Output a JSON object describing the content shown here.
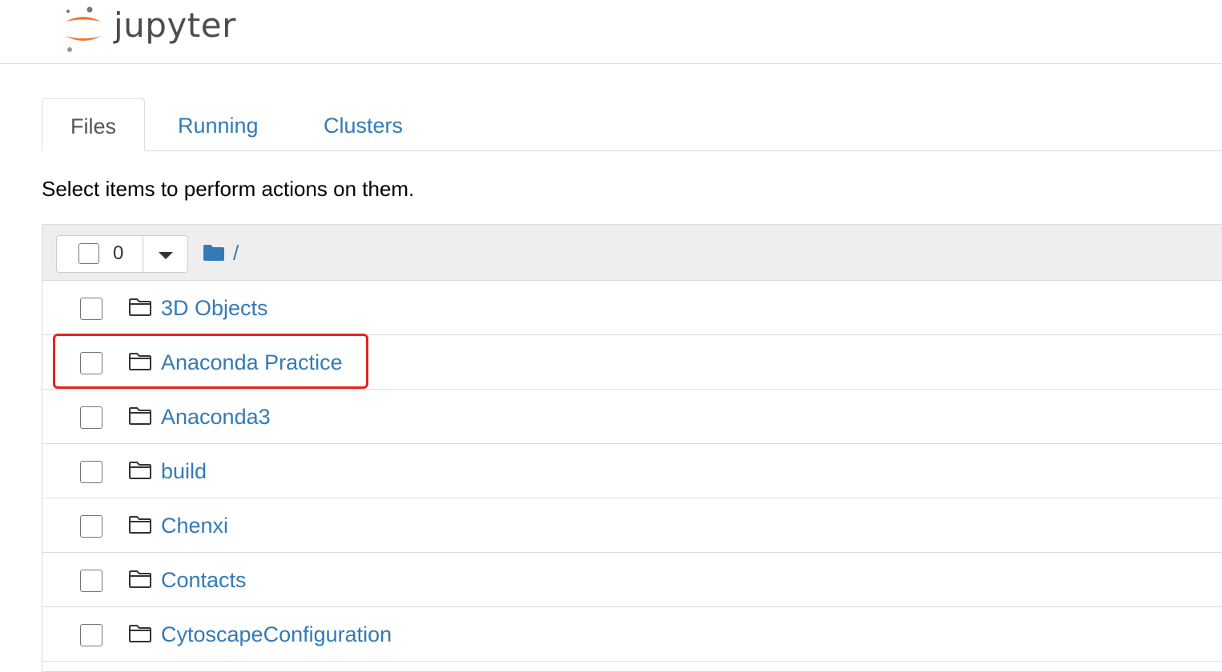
{
  "header": {
    "logo_text": "jupyter"
  },
  "tabs": [
    {
      "label": "Files",
      "active": true
    },
    {
      "label": "Running",
      "active": false
    },
    {
      "label": "Clusters",
      "active": false
    }
  ],
  "instructions": "Select items to perform actions on them.",
  "toolbar": {
    "selected_count": "0",
    "breadcrumb_root": "/"
  },
  "files": [
    {
      "name": "3D Objects",
      "type": "folder"
    },
    {
      "name": "Anaconda Practice",
      "type": "folder"
    },
    {
      "name": "Anaconda3",
      "type": "folder"
    },
    {
      "name": "build",
      "type": "folder"
    },
    {
      "name": "Chenxi",
      "type": "folder"
    },
    {
      "name": "Contacts",
      "type": "folder"
    },
    {
      "name": "CytoscapeConfiguration",
      "type": "folder"
    }
  ],
  "highlighted_file": "Anaconda Practice",
  "colors": {
    "link": "#337ab7",
    "logo_orange": "#f37726",
    "highlight": "#e8231f"
  }
}
